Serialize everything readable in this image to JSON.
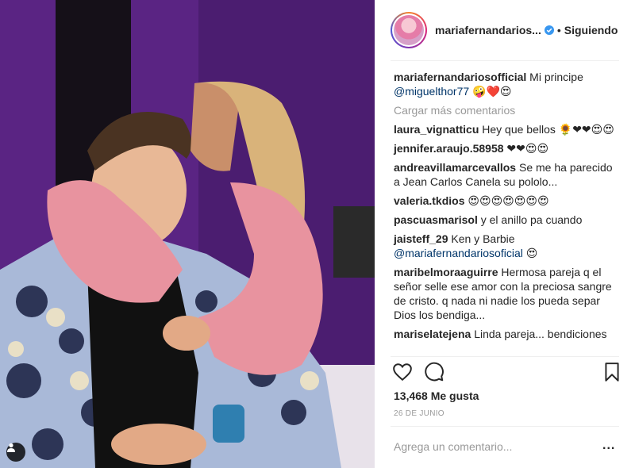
{
  "post": {
    "username": "mariafernandarios...",
    "follow_separator": "•",
    "follow_status": "Siguiendo",
    "caption": {
      "username": "mariafernandariosofficial",
      "text": "Mi principe",
      "mention": "@miguelthor77",
      "emoji": "🤪❤️😍"
    },
    "load_more": "Cargar más comentarios",
    "comments": [
      {
        "username": "laura_vignatticu",
        "text": "Hey que bellos 🌻❤❤😍😍"
      },
      {
        "username": "jennifer.araujo.58958",
        "text": "❤❤😍😍"
      },
      {
        "username": "andreavillamarcevallos",
        "text": "Se me ha parecido a Jean Carlos Canela su pololo..."
      },
      {
        "username": "valeria.tkdios",
        "text": "😍😍😍😍😍😍😍"
      },
      {
        "username": "pascuasmarisol",
        "text": "y el anillo pa cuando"
      },
      {
        "username": "jaisteff_29",
        "text": "Ken y Barbie",
        "mention": "@mariafernandariosoficial",
        "emoji": "😍"
      },
      {
        "username": "maribelmoraaguirre",
        "text": "Hermosa pareja q el señor selle ese amor con la preciosa sangre de cristo. q nada ni nadie los pueda separ Dios los bendiga..."
      },
      {
        "username": "mariselatejena",
        "text": "Linda pareja... bendiciones"
      }
    ],
    "likes": "13,468 Me gusta",
    "date": "26 DE JUNIO",
    "add_comment_placeholder": "Agrega un comentario...",
    "more_options": "..."
  },
  "icons": {
    "like": "heart-icon",
    "comment": "comment-bubble-icon",
    "save": "bookmark-icon",
    "verified": "verified-badge-icon",
    "tagged": "person-tag-icon"
  },
  "colors": {
    "text": "#262626",
    "muted": "#999999",
    "mention": "#003569",
    "verified": "#3897f0",
    "divider": "#efefef"
  }
}
